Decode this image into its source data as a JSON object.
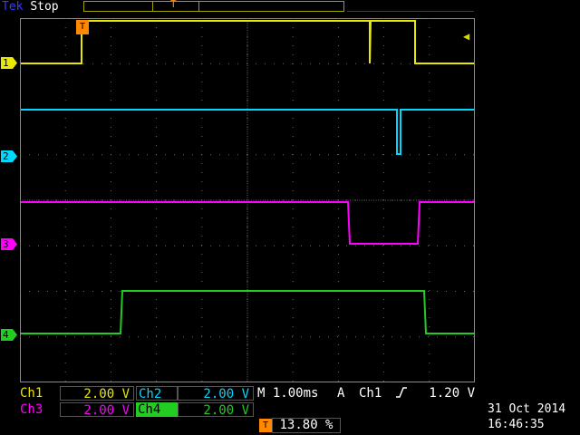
{
  "header": {
    "brand": "Tek",
    "state": "Stop"
  },
  "markers": {
    "trigger_position": "T",
    "channels": [
      {
        "label": "1",
        "color": "#e8e800"
      },
      {
        "label": "2",
        "color": "#00d8ff"
      },
      {
        "label": "3",
        "color": "#ff00ff"
      },
      {
        "label": "4",
        "color": "#22cc22"
      }
    ],
    "trigger_level_icon": "left-arrow-icon"
  },
  "readouts": {
    "ch1": {
      "label": "Ch1",
      "value": "2.00 V"
    },
    "ch2": {
      "label": "Ch2",
      "value": "2.00 V"
    },
    "ch3": {
      "label": "Ch3",
      "value": "2.00 V"
    },
    "ch4": {
      "label": "Ch4",
      "value": "2.00 V"
    },
    "timebase": "M 1.00ms",
    "trigger": {
      "mode": "A",
      "source": "Ch1",
      "slope_icon": "rising-edge-icon",
      "level": "1.20 V"
    },
    "trigger_position": {
      "icon": "T",
      "value": "13.80 %"
    },
    "date": "31 Oct  2014",
    "time": "16:46:35"
  },
  "colors": {
    "ch1": "#e8e800",
    "ch2": "#00d8ff",
    "ch3": "#ff00ff",
    "ch4": "#22cc22",
    "trigger": "#ff8800",
    "grid": "#6a6a6a"
  }
}
